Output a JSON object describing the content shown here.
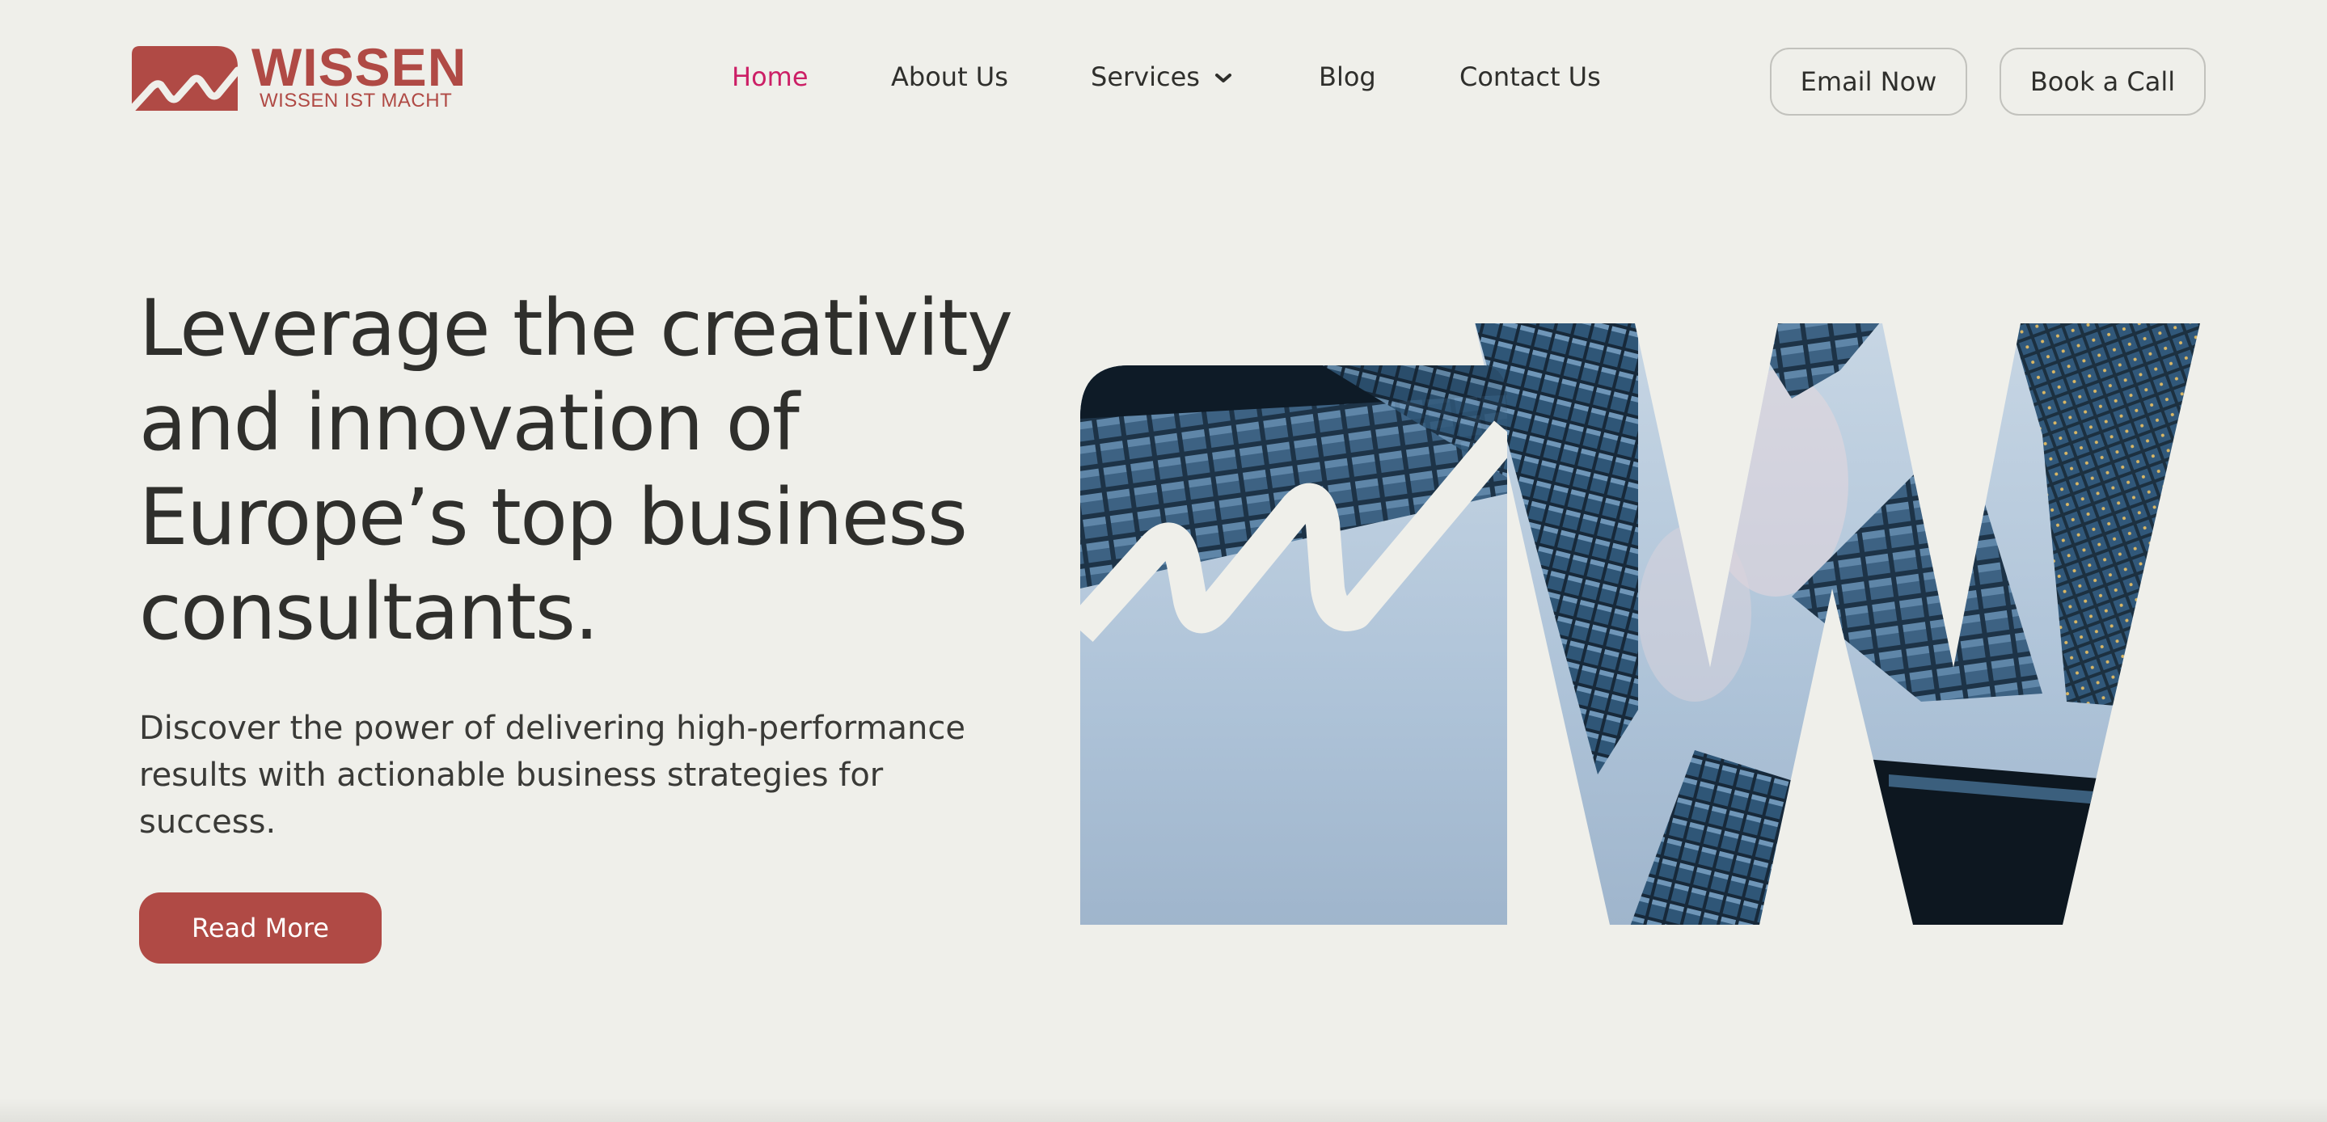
{
  "brand": {
    "name": "WISSEN",
    "tagline": "WISSEN IST MACHT",
    "color": "#b04a45"
  },
  "nav": {
    "items": [
      {
        "label": "Home",
        "active": true
      },
      {
        "label": "About Us"
      },
      {
        "label": "Services",
        "has_dropdown": true
      },
      {
        "label": "Blog"
      },
      {
        "label": "Contact Us"
      }
    ],
    "active_color": "#cc1f66"
  },
  "actions": {
    "email": "Email Now",
    "call": "Book a Call"
  },
  "hero": {
    "title": "Leverage the creativity and innovation of Europe’s top business consultants.",
    "subtitle": "Discover the power of delivering high-performance results with actionable business strategies for success.",
    "cta": "Read More",
    "cta_color": "#b04a45"
  },
  "icons": {
    "dropdown": "chevron-down-icon",
    "logo_mark": "wave-logo-icon"
  }
}
